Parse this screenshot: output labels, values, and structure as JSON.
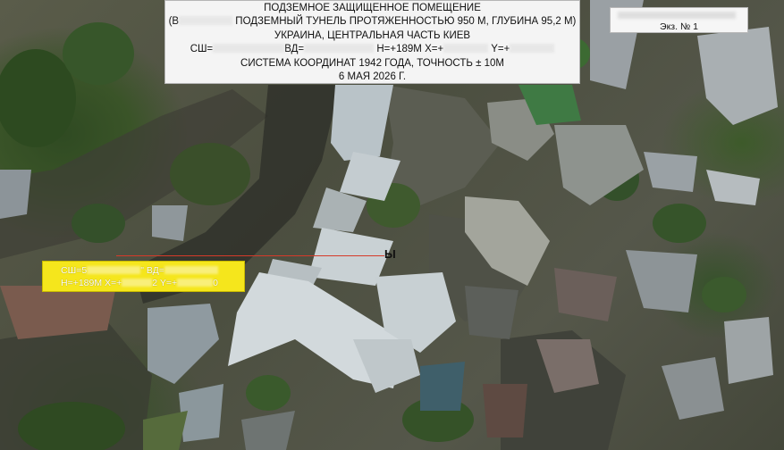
{
  "header": {
    "title": "ПОДЗЕМНОЕ ЗАЩИЩЕННОЕ ПОМЕЩЕНИЕ",
    "line2_prefix": "(В",
    "line2_rest": "ПОДЗЕМНЫЙ ТУНЕЛЬ ПРОТЯЖЕННОСТЬЮ 950 М, ГЛУБИНА 95,2 М)",
    "line3": "УКРАИНА, ЦЕНТРАЛЬНАЯ ЧАСТЬ КИЕВ",
    "coords_a": "СШ=",
    "coords_b": "ВД=",
    "coords_c": "H=+189М X=+",
    "coords_d": "Y=+",
    "line5": "СИСТЕМА КООРДИНАТ 1942 ГОДА, ТОЧНОСТЬ ± 10М",
    "line6": "6 МАЯ 2026 Г."
  },
  "copy_box": {
    "label": "Экз. № 1"
  },
  "coord_box": {
    "l1_a": "СШ=5",
    "l1_b": "\" ВД=",
    "l2_a": "H=+189М X=+",
    "l2_b": "2 Y=+",
    "l2_c": "0"
  },
  "map_marker": {
    "label": "Ы",
    "line_color": "#d63a2a"
  },
  "colors": {
    "label_box_bg": "#f5e61c",
    "header_bg": "#f4f4f4"
  }
}
